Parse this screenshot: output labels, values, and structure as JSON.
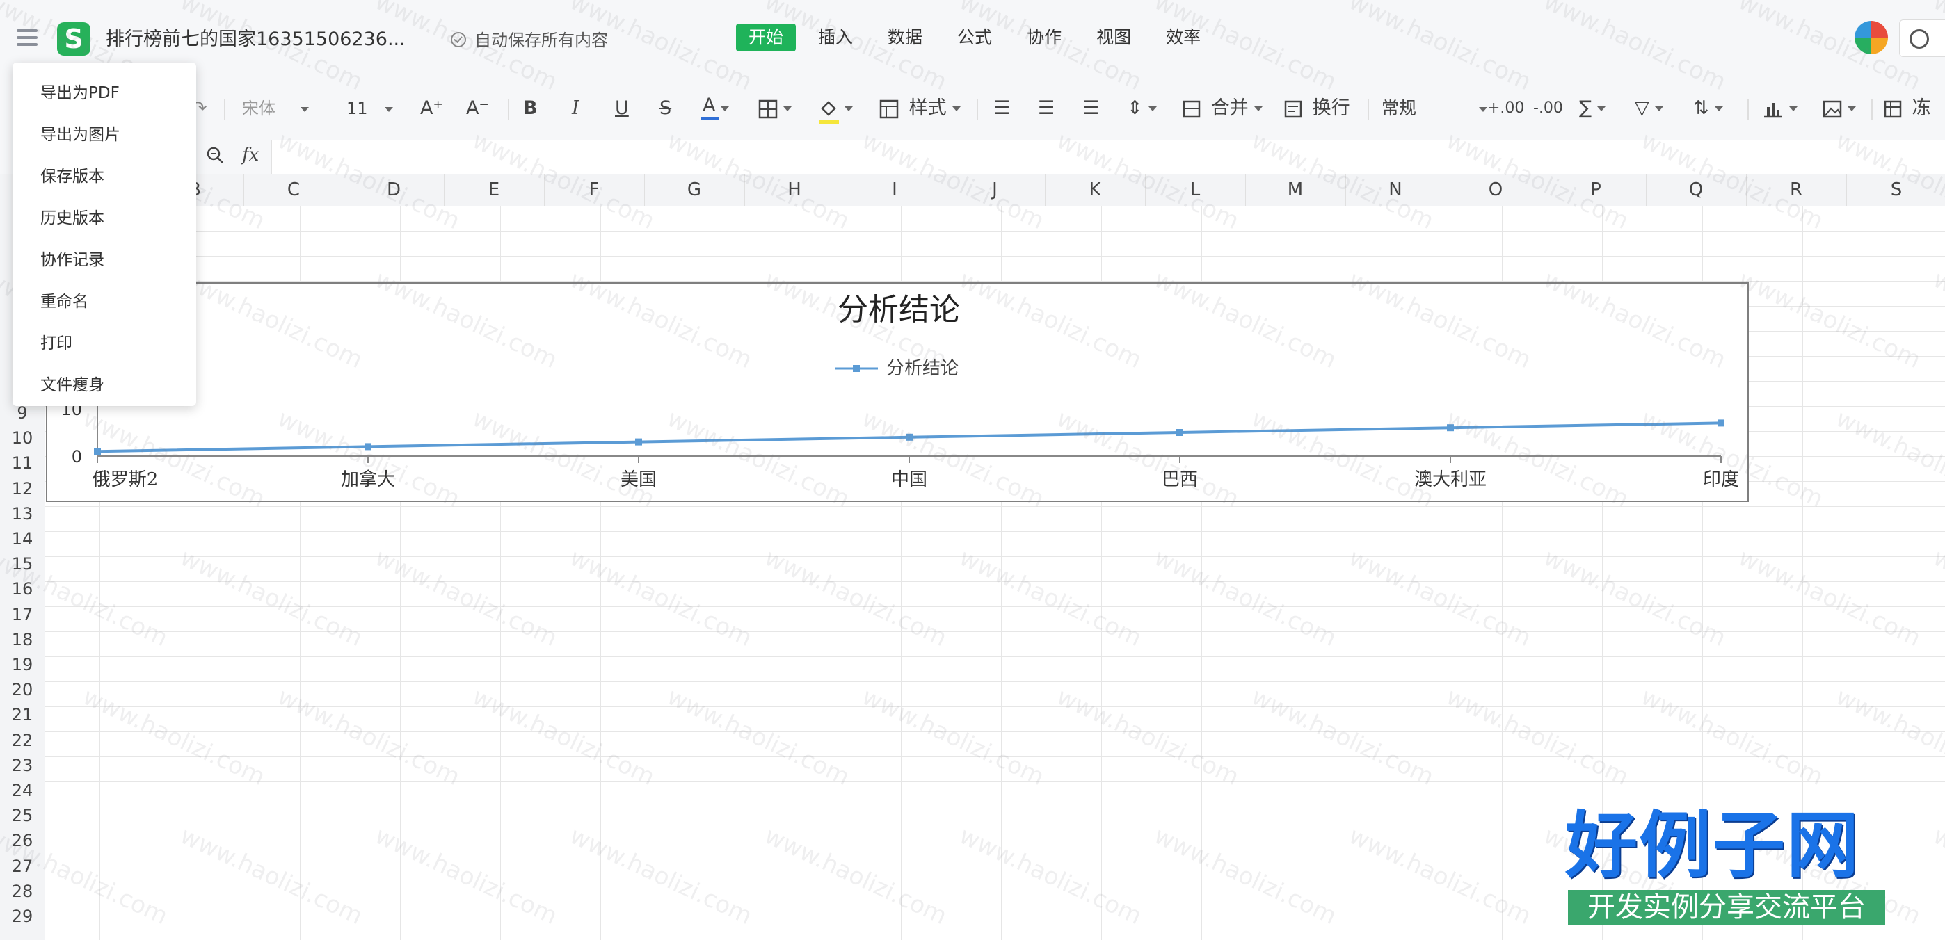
{
  "app": {
    "logo_letter": "S",
    "doc_title": "排行榜前七的国家16351506236...",
    "autosave_text": "自动保存所有内容"
  },
  "main_tabs": [
    {
      "label": "开始",
      "active": true
    },
    {
      "label": "插入",
      "active": false
    },
    {
      "label": "数据",
      "active": false
    },
    {
      "label": "公式",
      "active": false
    },
    {
      "label": "协作",
      "active": false
    },
    {
      "label": "视图",
      "active": false
    },
    {
      "label": "效率",
      "active": false
    }
  ],
  "toolbar": {
    "font_name": "宋体",
    "font_size": "11",
    "increase_font": "A⁺",
    "decrease_font": "A⁻",
    "bold": "B",
    "italic": "I",
    "underline": "U",
    "strike": "S",
    "font_color": "A",
    "style_label": "样式",
    "merge_label": "合并",
    "wrap_label": "换行",
    "number_format": "常规",
    "freeze_label": "冻",
    "highlight_color": "#f5e63b",
    "font_color_bar": "#2f6fd6"
  },
  "formula_bar": {
    "fx": "fx",
    "value": ""
  },
  "columns": [
    "C",
    "D",
    "E",
    "F",
    "G",
    "H",
    "I",
    "J",
    "K",
    "L",
    "M",
    "N",
    "O",
    "P",
    "Q",
    "R",
    "S"
  ],
  "rows": [
    "9",
    "10",
    "11",
    "12",
    "13",
    "14",
    "15",
    "16",
    "17",
    "18",
    "19",
    "20",
    "21",
    "22",
    "23",
    "24",
    "25",
    "26",
    "27",
    "28",
    "29"
  ],
  "partial_column": "B",
  "file_menu": {
    "items": [
      "导出为PDF",
      "导出为图片",
      "保存版本",
      "历史版本",
      "协作记录",
      "重命名",
      "打印",
      "文件瘦身"
    ]
  },
  "chart_data": {
    "type": "line",
    "title": "分析结论",
    "categories": [
      "俄罗斯2",
      "加拿大",
      "美国",
      "中国",
      "巴西",
      "澳大利亚",
      "印度"
    ],
    "series": [
      {
        "name": "分析结论",
        "values": [
          1,
          2,
          3,
          4,
          5,
          6,
          7
        ],
        "color": "#5b9bd5"
      }
    ],
    "y_ticks": [
      "0",
      "10"
    ],
    "ylim": [
      0,
      10
    ],
    "legend_position": "top",
    "grid": false
  },
  "watermark_text": "www.haolizi.com",
  "site_logo": {
    "title": "好例子网",
    "subtitle": "开发实例分享交流平台"
  }
}
